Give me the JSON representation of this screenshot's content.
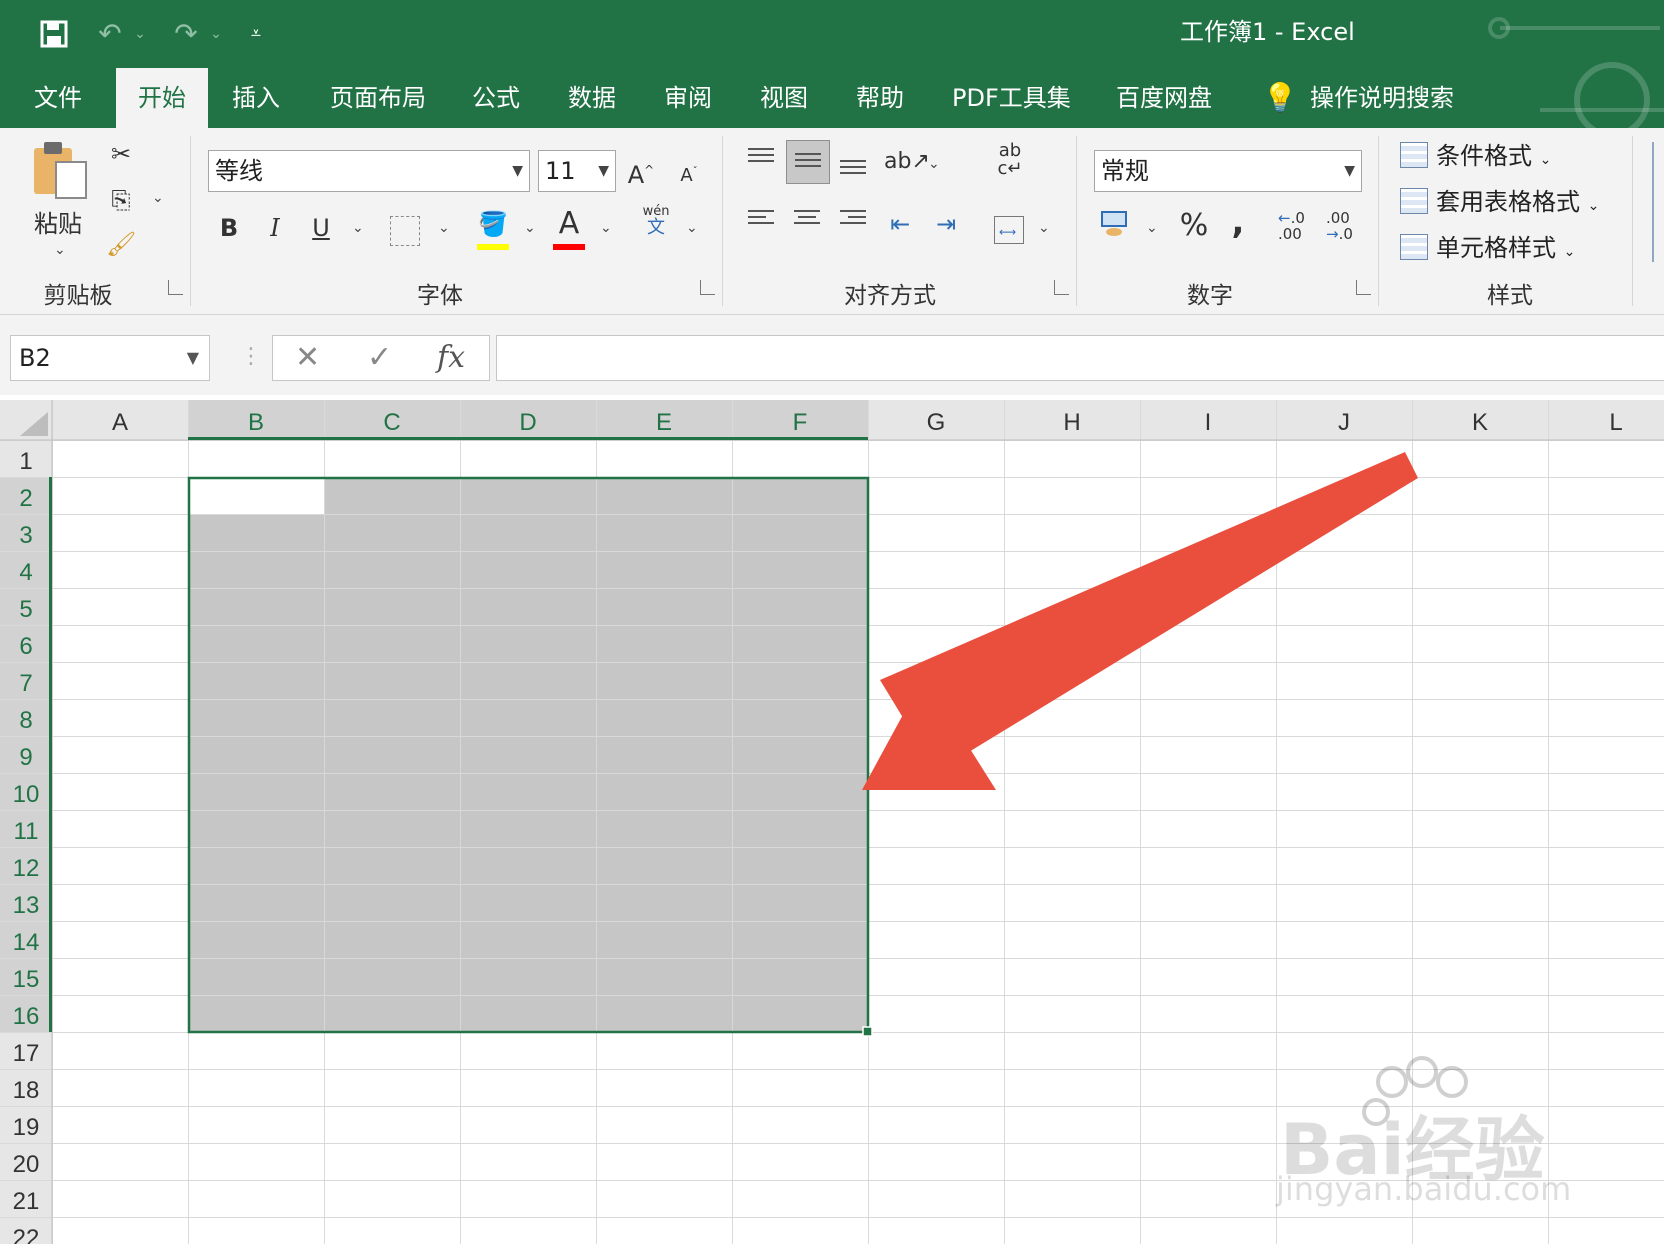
{
  "window": {
    "title": "工作簿1  -  Excel"
  },
  "ribbon_tabs": [
    {
      "label": "文件"
    },
    {
      "label": "开始"
    },
    {
      "label": "插入"
    },
    {
      "label": "页面布局"
    },
    {
      "label": "公式"
    },
    {
      "label": "数据"
    },
    {
      "label": "审阅"
    },
    {
      "label": "视图"
    },
    {
      "label": "帮助"
    },
    {
      "label": "PDF工具集"
    },
    {
      "label": "百度网盘"
    },
    {
      "label": "操作说明搜索"
    }
  ],
  "active_tab": "开始",
  "clipboard": {
    "paste_label": "粘贴",
    "group_label": "剪贴板"
  },
  "font": {
    "name": "等线",
    "size": "11",
    "group_label": "字体",
    "bold": "B",
    "italic": "I",
    "underline": "U",
    "pinyin": "wén",
    "pinyin_char": "文",
    "fill_color": "#ffff00",
    "font_color": "#ff0000"
  },
  "alignment": {
    "group_label": "对齐方式"
  },
  "number": {
    "format": "常规",
    "group_label": "数字",
    "percent": "%",
    "comma": ",",
    "inc_decimal": ".00",
    "dec_decimal": ".00"
  },
  "styles": {
    "group_label": "样式",
    "conditional": "条件格式",
    "table": "套用表格格式",
    "cell": "单元格样式"
  },
  "formula_bar": {
    "name_box": "B2",
    "fx": "fx",
    "cancel": "✕",
    "enter": "✓",
    "value": ""
  },
  "sheet": {
    "columns": [
      "A",
      "B",
      "C",
      "D",
      "E",
      "F",
      "G",
      "H",
      "I",
      "J",
      "K",
      "L"
    ],
    "rows": [
      "1",
      "2",
      "3",
      "4",
      "5",
      "6",
      "7",
      "8",
      "9",
      "10",
      "11",
      "12",
      "13",
      "14",
      "15",
      "16",
      "17",
      "18",
      "19",
      "20",
      "21",
      "22"
    ],
    "selection": {
      "range": "B2:F16",
      "active_cell": "B2"
    }
  },
  "colors": {
    "excel_green": "#217346",
    "selection_fill": "#c6c6c6",
    "annotation_arrow": "#ea4e3d"
  },
  "watermark": {
    "brand": "Bai经验",
    "url": "jingyan.baidu.com"
  }
}
